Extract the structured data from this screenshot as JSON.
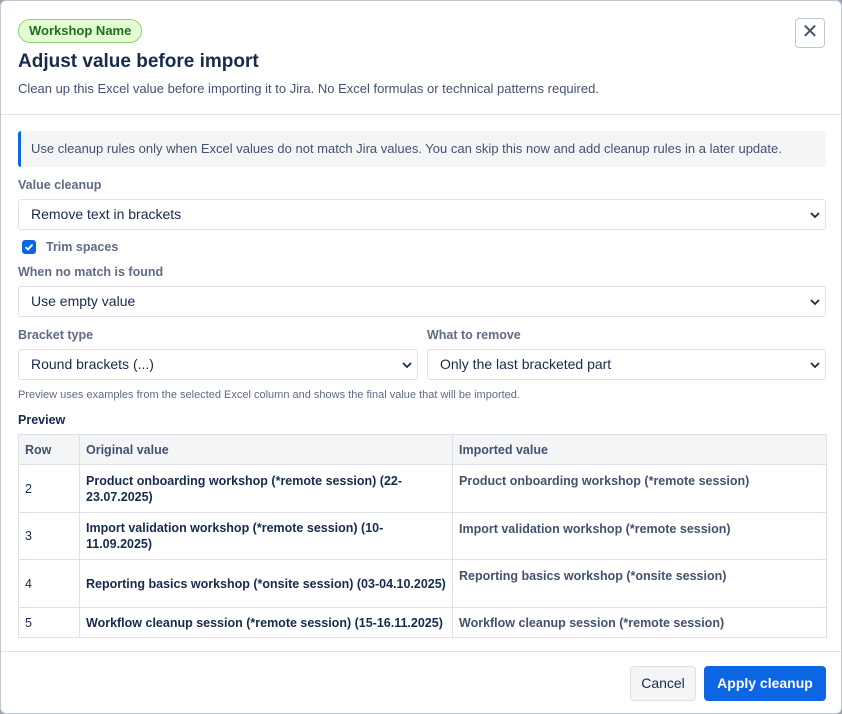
{
  "header": {
    "badge": "Workshop Name",
    "title": "Adjust value before import",
    "subtitle": "Clean up this Excel value before importing it to Jira. No Excel formulas or technical patterns required.",
    "close_icon": "close-icon"
  },
  "info": "Use cleanup rules only when Excel values do not match Jira values. You can skip this now and add cleanup rules in a later update.",
  "value_cleanup": {
    "label": "Value cleanup",
    "value": "Remove text in brackets"
  },
  "trim_spaces": {
    "label": "Trim spaces",
    "checked": true
  },
  "no_match": {
    "label": "When no match is found",
    "value": "Use empty value"
  },
  "bracket_type": {
    "label": "Bracket type",
    "value": "Round brackets (...)"
  },
  "what_to_remove": {
    "label": "What to remove",
    "value": "Only the last bracketed part"
  },
  "note": "Preview uses examples from the selected Excel column and shows the final value that will be imported.",
  "preview": {
    "title": "Preview",
    "columns": [
      "Row",
      "Original value",
      "Imported value"
    ],
    "rows": [
      {
        "row": "2",
        "original": "Product onboarding workshop (*remote session) (22-23.07.2025)",
        "imported": "Product onboarding workshop (*remote session)"
      },
      {
        "row": "3",
        "original": "Import validation workshop (*remote session) (10-11.09.2025)",
        "imported": "Import validation workshop (*remote session)"
      },
      {
        "row": "4",
        "original": "Reporting basics workshop (*onsite session) (03-04.10.2025)",
        "imported": "Reporting basics workshop (*onsite session)"
      },
      {
        "row": "5",
        "original": "Workflow cleanup session (*remote session) (15-16.11.2025)",
        "imported": "Workflow cleanup session (*remote session)"
      }
    ]
  },
  "footer": {
    "cancel": "Cancel",
    "apply": "Apply cleanup"
  },
  "colors": {
    "accent": "#0c66e4",
    "badge_bg": "#e3fcd4",
    "badge_text": "#1f6f1b"
  }
}
